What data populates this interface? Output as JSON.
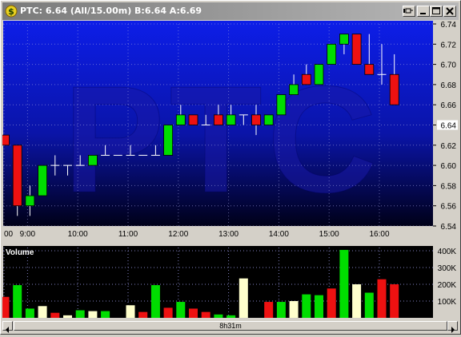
{
  "window": {
    "title": "PTC: 6.64 (All/15.00m)  B:6.64  A:6.69",
    "icon": "dollar-coin-icon",
    "buttons": [
      "pin-icon",
      "minimize-icon",
      "maximize-icon",
      "close-icon"
    ]
  },
  "colors": {
    "up": "#00dd00",
    "down": "#ee1111",
    "unchanged": "#ffffcc",
    "watermark": "#2020a0",
    "grid": "#a0a0e0"
  },
  "price_axis": {
    "labels": [
      "6.74",
      "6.72",
      "6.70",
      "6.68",
      "6.66",
      "6.64",
      "6.62",
      "6.60",
      "6.58",
      "6.56",
      "6.54"
    ],
    "min": 6.54,
    "max": 6.74,
    "highlight": "6.64"
  },
  "time_axis": {
    "labels": [
      "00",
      "9:00",
      "10:00",
      "11:00",
      "12:00",
      "13:00",
      "14:00",
      "15:00",
      "16:00"
    ]
  },
  "watermark": "PTC",
  "volume_panel": {
    "title": "Volume",
    "axis_labels": [
      "400K",
      "300K",
      "200K",
      "100K"
    ]
  },
  "scrollbar": {
    "label": "8h31m",
    "left_arrow": "scroll-left-icon",
    "right_arrow": "scroll-right-icon"
  },
  "chart_data": [
    {
      "type": "candlestick",
      "symbol": "PTC",
      "interval": "15m",
      "ylim": [
        6.54,
        6.74
      ],
      "x": [
        "8:30",
        "8:45",
        "9:00",
        "9:15",
        "9:30",
        "9:45",
        "10:00",
        "10:15",
        "10:30",
        "10:45",
        "11:00",
        "11:15",
        "11:30",
        "11:45",
        "12:00",
        "12:15",
        "12:30",
        "12:45",
        "13:00",
        "13:15",
        "13:30",
        "13:45",
        "14:00",
        "14:15",
        "14:30",
        "14:45",
        "15:00",
        "15:15",
        "15:30",
        "15:45",
        "16:00",
        "16:15"
      ],
      "open": [
        6.63,
        6.62,
        6.56,
        6.57,
        6.6,
        6.6,
        6.6,
        6.6,
        6.61,
        6.61,
        6.61,
        6.61,
        6.61,
        6.61,
        6.64,
        6.65,
        6.64,
        6.65,
        6.64,
        6.65,
        6.65,
        6.64,
        6.65,
        6.67,
        6.69,
        6.68,
        6.7,
        6.72,
        6.73,
        6.7,
        6.69,
        6.69
      ],
      "high": [
        6.63,
        6.62,
        6.58,
        6.6,
        6.61,
        6.6,
        6.61,
        6.61,
        6.62,
        6.61,
        6.62,
        6.61,
        6.62,
        6.63,
        6.66,
        6.65,
        6.65,
        6.66,
        6.66,
        6.65,
        6.66,
        6.65,
        6.67,
        6.69,
        6.7,
        6.69,
        6.72,
        6.73,
        6.73,
        6.73,
        6.72,
        6.71
      ],
      "low": [
        6.62,
        6.55,
        6.55,
        6.57,
        6.59,
        6.59,
        6.6,
        6.6,
        6.61,
        6.61,
        6.61,
        6.61,
        6.61,
        6.61,
        6.64,
        6.64,
        6.64,
        6.64,
        6.64,
        6.64,
        6.63,
        6.64,
        6.65,
        6.67,
        6.68,
        6.68,
        6.7,
        6.71,
        6.72,
        6.69,
        6.68,
        6.66
      ],
      "close": [
        6.62,
        6.56,
        6.57,
        6.6,
        6.6,
        6.6,
        6.6,
        6.61,
        6.61,
        6.61,
        6.61,
        6.61,
        6.61,
        6.64,
        6.65,
        6.64,
        6.64,
        6.64,
        6.65,
        6.65,
        6.64,
        6.65,
        6.67,
        6.68,
        6.68,
        6.7,
        6.72,
        6.73,
        6.7,
        6.69,
        6.69,
        6.66
      ]
    },
    {
      "type": "bar",
      "title": "Volume",
      "ylim": [
        0,
        400000
      ],
      "x": [
        "8:30",
        "8:45",
        "9:00",
        "9:15",
        "9:30",
        "9:45",
        "10:00",
        "10:15",
        "10:30",
        "10:45",
        "11:00",
        "11:15",
        "11:30",
        "11:45",
        "12:00",
        "12:15",
        "12:30",
        "12:45",
        "13:00",
        "13:15",
        "13:30",
        "13:45",
        "14:00",
        "14:15",
        "14:30",
        "14:45",
        "15:00",
        "15:15",
        "15:30",
        "15:45",
        "16:00",
        "16:15"
      ],
      "values": [
        125000,
        195000,
        55000,
        70000,
        30000,
        15000,
        45000,
        40000,
        40000,
        0,
        75000,
        35000,
        195000,
        60000,
        95000,
        55000,
        35000,
        20000,
        15000,
        235000,
        0,
        95000,
        95000,
        100000,
        140000,
        135000,
        175000,
        405000,
        200000,
        150000,
        230000,
        200000
      ],
      "direction": [
        "down",
        "up",
        "up",
        "same",
        "down",
        "same",
        "up",
        "same",
        "up",
        "same",
        "same",
        "down",
        "up",
        "down",
        "up",
        "down",
        "down",
        "up",
        "up",
        "same",
        "same",
        "down",
        "up",
        "same",
        "up",
        "up",
        "down",
        "up",
        "same",
        "up",
        "down",
        "down"
      ]
    }
  ]
}
